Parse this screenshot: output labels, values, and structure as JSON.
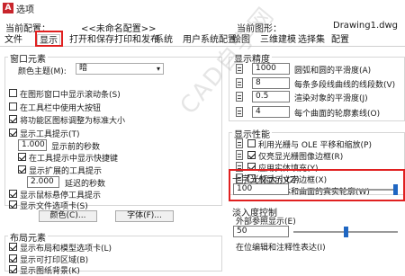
{
  "window": {
    "title": "选项"
  },
  "header": {
    "current_profile_label": "当前配置：",
    "current_profile_value": "<<未命名配置>>",
    "current_drawing_label": "当前图形：",
    "current_drawing_value": "Drawing1.dwg"
  },
  "tabs": [
    "文件",
    "显示",
    "打开和保存",
    "打印和发布",
    "系统",
    "用户系统配置",
    "绘图",
    "三维建模",
    "选择集",
    "配置"
  ],
  "active_tab": "显示",
  "window_elements": {
    "title": "窗口元素",
    "color_theme_label": "颜色主题(M):",
    "color_theme_value": "暗",
    "items": [
      {
        "label": "在图形窗口中显示滚动条(S)",
        "checked": false
      },
      {
        "label": "在工具栏中使用大按钮",
        "checked": false
      },
      {
        "label": "将功能区图标调整为标准大小",
        "checked": true
      },
      {
        "label": "显示工具提示(T)",
        "checked": true
      }
    ],
    "tooltip_delay_value": "1.000",
    "tooltip_delay_label": "显示前的秒数",
    "shortcut_in_tooltip_label": "在工具提示中显示快捷键",
    "extended_tooltips_label": "显示扩展的工具提示",
    "extended_delay_value": "2.000",
    "extended_delay_label": "延迟的秒数",
    "rollover_tooltips_label": "显示鼠标悬停工具提示",
    "file_tabs_label": "显示文件选项卡(S)",
    "colors_button": "颜色(C)...",
    "fonts_button": "字体(F)..."
  },
  "layout_elements": {
    "title": "布局元素",
    "items": [
      {
        "label": "显示布局和模型选项卡(L)",
        "checked": true
      },
      {
        "label": "显示可打印区域(B)",
        "checked": true
      },
      {
        "label": "显示图纸背景(K)",
        "checked": true
      }
    ]
  },
  "display_resolution": {
    "title": "显示精度",
    "items": [
      {
        "value": "1000",
        "label": "圆弧和圆的平滑度(A)"
      },
      {
        "value": "8",
        "label": "每条多段线曲线的线段数(V)"
      },
      {
        "value": "0.5",
        "label": "渲染对象的平滑度(J)"
      },
      {
        "value": "4",
        "label": "每个曲面的轮廓素线(O)"
      }
    ]
  },
  "display_performance": {
    "title": "显示性能",
    "items": [
      {
        "label": "利用光栅与 OLE 平移和缩放(P)",
        "checked": false
      },
      {
        "label": "仅亮显光栅图像边框(R)",
        "checked": true
      },
      {
        "label": "应用实体填充(Y)",
        "checked": true
      },
      {
        "label": "仅显示文字边框(X)",
        "checked": false
      },
      {
        "label": "绘制实体和曲面的真实轮廓(W)",
        "checked": false
      }
    ]
  },
  "crosshair": {
    "title": "十字光标大小(Z)",
    "value": "100",
    "level_percent": 100
  },
  "fade_control": {
    "title": "淡入度控制",
    "xref_label": "外部参照显示(E)",
    "xref_value": "50",
    "in_place_label": "在位编辑和注释性表达(I)"
  },
  "watermark": "CAD自学网"
}
